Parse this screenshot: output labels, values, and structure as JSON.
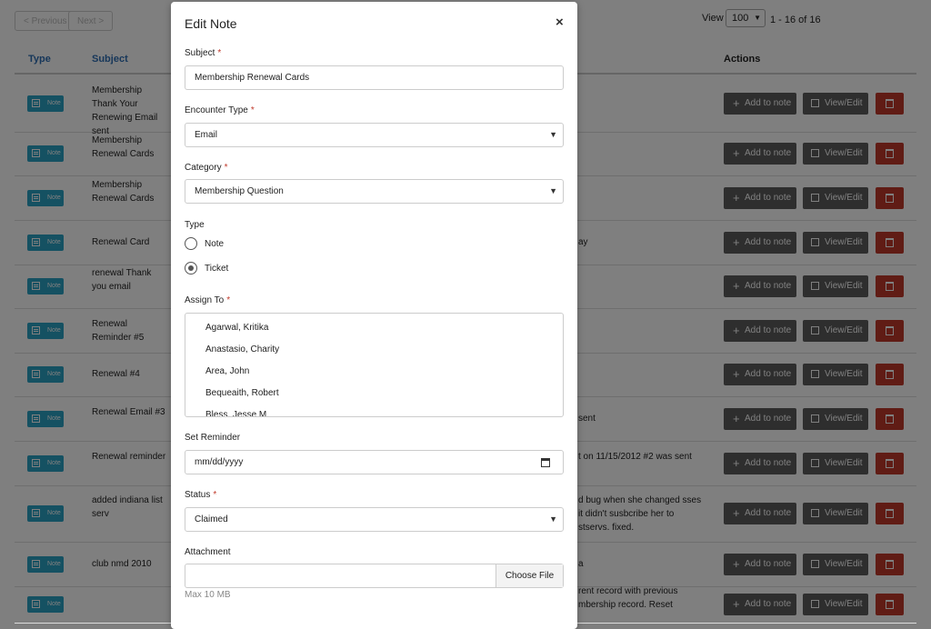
{
  "pager": {
    "previous": "< Previous",
    "next": "Next >"
  },
  "view": {
    "label": "View",
    "value": "100",
    "range": "1 - 16 of 16"
  },
  "table": {
    "headers": {
      "type": "Type",
      "subject": "Subject",
      "actions": "Actions"
    },
    "buttons": {
      "add": "Add to note",
      "view": "View/Edit"
    },
    "badge_label": "Note",
    "rows": [
      {
        "subject": "Membership Thank Your Renewing Email sent",
        "desc": ""
      },
      {
        "subject": "Membership Renewal Cards",
        "desc": ""
      },
      {
        "subject": "Membership Renewal Cards",
        "desc": ""
      },
      {
        "subject": "Renewal Card",
        "desc": "ay"
      },
      {
        "subject": "renewal Thank you email",
        "desc": ""
      },
      {
        "subject": "Renewal Reminder #5",
        "desc": ""
      },
      {
        "subject": "Renewal #4",
        "desc": ""
      },
      {
        "subject": "Renewal Email #3",
        "desc": "sent"
      },
      {
        "subject": "Renewal reminder",
        "desc": "t on 11/15/2012 #2 was sent"
      },
      {
        "subject": "added indiana list serv",
        "desc": "d bug when she changed sses it didn't susbcribe her to stservs. fixed."
      },
      {
        "subject": "club nmd 2010",
        "desc": "a"
      },
      {
        "subject": "",
        "desc": "rent record with previous mbership record. Reset"
      }
    ]
  },
  "modal": {
    "title": "Edit Note",
    "close": "×",
    "required_mark": "*",
    "subject": {
      "label": "Subject",
      "value": "Membership Renewal Cards"
    },
    "encounter_type": {
      "label": "Encounter Type",
      "value": "Email"
    },
    "category": {
      "label": "Category",
      "value": "Membership Question"
    },
    "type": {
      "label": "Type",
      "options": [
        "Note",
        "Ticket"
      ],
      "selected": "Ticket"
    },
    "assign_to": {
      "label": "Assign To",
      "options": [
        "Agarwal, Kritika",
        "Anastasio, Charity",
        "Area, John",
        "Bequeaith, Robert",
        "Bless, Jesse M."
      ]
    },
    "reminder": {
      "label": "Set Reminder",
      "placeholder": "mm/dd/yyyy"
    },
    "status": {
      "label": "Status",
      "value": "Claimed"
    },
    "attachment": {
      "label": "Attachment",
      "button": "Choose File",
      "hint": "Max 10 MB"
    }
  },
  "colors": {
    "note_badge": "#2aa2c4",
    "delete": "#c0392b",
    "action": "#5c5c5c",
    "link": "#2f6fb5"
  }
}
